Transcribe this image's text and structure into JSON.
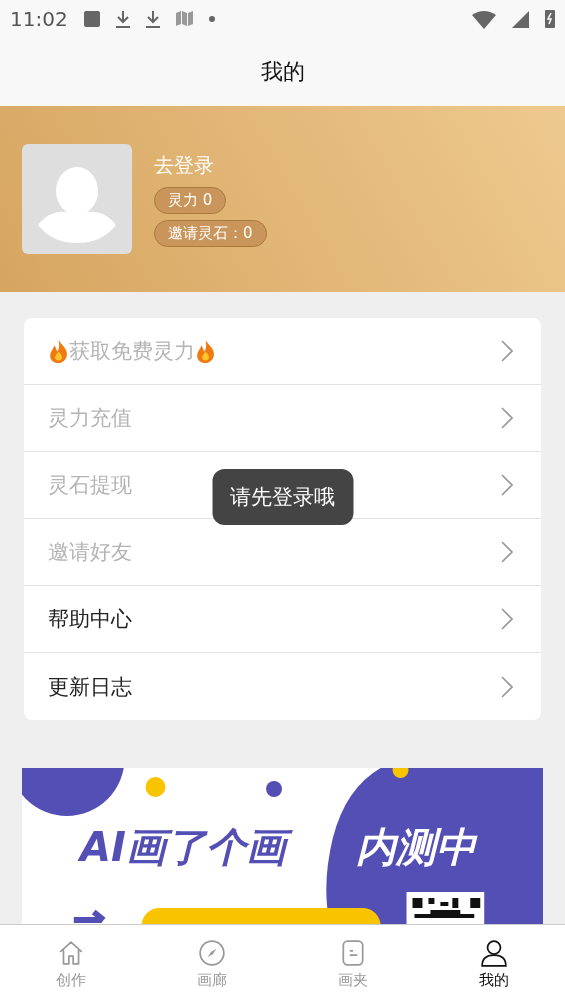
{
  "status_bar": {
    "time": "11:02"
  },
  "header": {
    "title": "我的"
  },
  "profile": {
    "login": "去登录",
    "badges": [
      "灵力 0",
      "邀请灵石：0"
    ]
  },
  "menu": [
    {
      "label": "获取免费灵力",
      "flames": true,
      "disabled": true
    },
    {
      "label": "灵力充值",
      "flames": false,
      "disabled": true
    },
    {
      "label": "灵石提现",
      "flames": false,
      "disabled": true
    },
    {
      "label": "邀请好友",
      "flames": false,
      "disabled": true
    },
    {
      "label": "帮助中心",
      "flames": false,
      "disabled": false
    },
    {
      "label": "更新日志",
      "flames": false,
      "disabled": false
    }
  ],
  "toast": "请先登录哦",
  "banner": {
    "title": "AI画了个画",
    "tag": "内测中"
  },
  "tab_bar": [
    {
      "label": "创作",
      "kind": "home",
      "selected": false
    },
    {
      "label": "画廊",
      "kind": "compass",
      "selected": false
    },
    {
      "label": "画夹",
      "kind": "note",
      "selected": false
    },
    {
      "label": "我的",
      "kind": "person",
      "selected": true
    }
  ]
}
